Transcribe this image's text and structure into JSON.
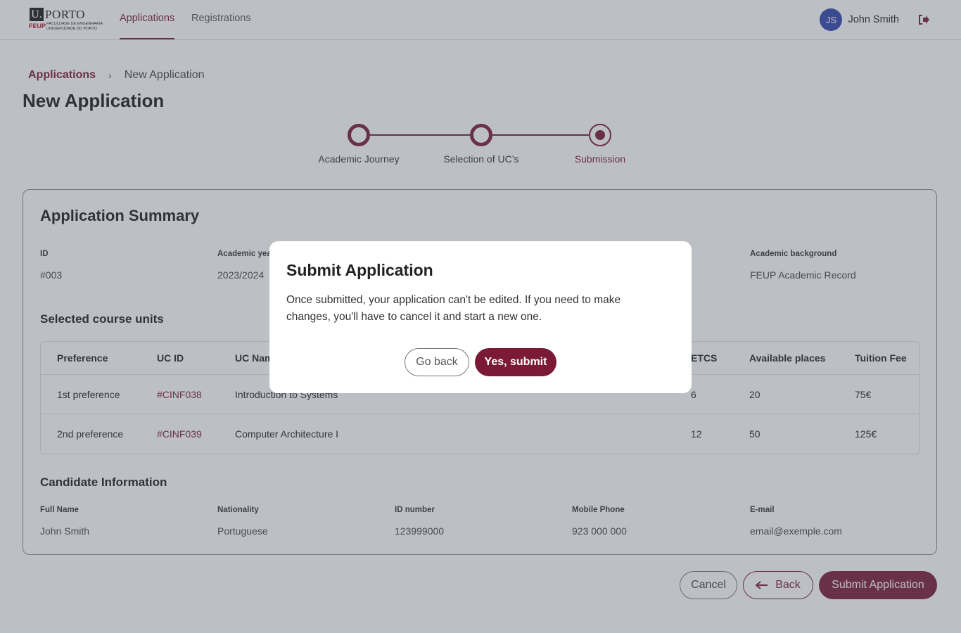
{
  "brand": {
    "letter": "U.",
    "name": "PORTO",
    "faculty_short": "FEUP",
    "faculty_line1": "FACULDADE DE ENGENHARIA",
    "faculty_line2": "UNIVERSIDADE DO PORTO"
  },
  "nav": {
    "tabs": [
      {
        "label": "Applications",
        "active": true
      },
      {
        "label": "Registrations",
        "active": false
      }
    ]
  },
  "user": {
    "initials": "JS",
    "name": "John Smith",
    "avatar_color": "#2f45b0"
  },
  "icons": {
    "logout": "logout-icon",
    "back_arrow": "arrow-left-icon",
    "chevron": "chevron-right-icon"
  },
  "colors": {
    "accent": "#7a1a36"
  },
  "breadcrumb": {
    "root": "Applications",
    "current": "New Application"
  },
  "page": {
    "title": "New Application"
  },
  "stepper": {
    "steps": [
      {
        "label": "Academic Journey",
        "state": "done"
      },
      {
        "label": "Selection of UC’s",
        "state": "done"
      },
      {
        "label": "Submission",
        "state": "current"
      }
    ]
  },
  "summary": {
    "title": "Application Summary",
    "fields": [
      {
        "label": "ID",
        "value": "#003"
      },
      {
        "label": "Academic yea",
        "value": "2023/2024"
      },
      {
        "label": "Academic background",
        "value": "FEUP Academic Record"
      }
    ],
    "courses_title": "Selected course units",
    "table": {
      "headers": [
        "Preference",
        "UC ID",
        "UC Nam",
        "ETCS",
        "Available places",
        "Tuition Fee"
      ],
      "rows": [
        [
          "1st preference",
          "#CINF038",
          "Introduction to Systems",
          "6",
          "20",
          "75€"
        ],
        [
          "2nd preference",
          "#CINF039",
          "Computer Architecture I",
          "12",
          "50",
          "125€"
        ]
      ]
    },
    "candidate_title": "Candidate Information",
    "candidate": [
      {
        "label": "Full Name",
        "value": "John Smith"
      },
      {
        "label": "Nationality",
        "value": "Portuguese"
      },
      {
        "label": "ID number",
        "value": "123999000"
      },
      {
        "label": "Mobile Phone",
        "value": "923 000 000"
      },
      {
        "label": "E-mail",
        "value": "email@exemple.com"
      }
    ]
  },
  "actions": {
    "cancel": "Cancel",
    "back": "Back",
    "submit": "Submit Application"
  },
  "modal": {
    "title": "Submit Application",
    "message": "Once submitted, your application can't be edited. If you need to make changes, you'll have to cancel it and start a new one.",
    "go_back": "Go back",
    "confirm": "Yes, submit"
  }
}
